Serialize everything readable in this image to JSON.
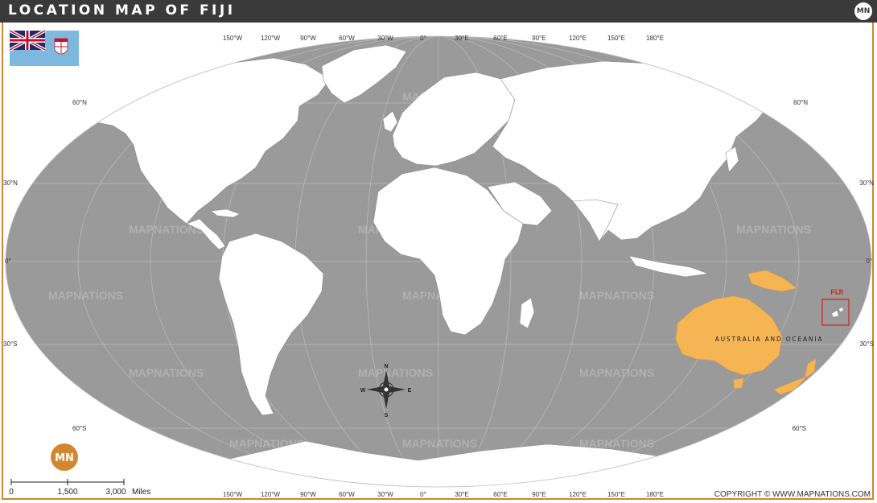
{
  "title": "LOCATION MAP OF FIJI",
  "logo_text": "MN",
  "watermark": "MAPNATIONS",
  "country_label": "FIJI",
  "region_label": "AUSTRALIA AND OCEANIA",
  "graticule": {
    "longitudes": [
      "150°W",
      "120°W",
      "90°W",
      "60°W",
      "30°W",
      "0°",
      "30°E",
      "60°E",
      "90°E",
      "120°E",
      "150°E",
      "180°E"
    ],
    "lat_left": [
      "60°N",
      "30°N",
      "0°",
      "30°S",
      "60°S"
    ],
    "lat_right": [
      "60°N",
      "30°N",
      "0°",
      "30°S",
      "60°S"
    ]
  },
  "compass": {
    "n": "N",
    "s": "S",
    "e": "E",
    "w": "W"
  },
  "scale": {
    "labels": [
      "0",
      "1,500",
      "3,000"
    ],
    "unit": "Miles"
  },
  "copyright": "COPYRIGHT © WWW.MAPNATIONS.COM",
  "colors": {
    "ocean": "#9a9a9a",
    "land": "#ffffff",
    "highlight": "#f5b553",
    "accent": "#d4862e",
    "title_bar": "#3a3a3a",
    "marker": "#d42020"
  }
}
